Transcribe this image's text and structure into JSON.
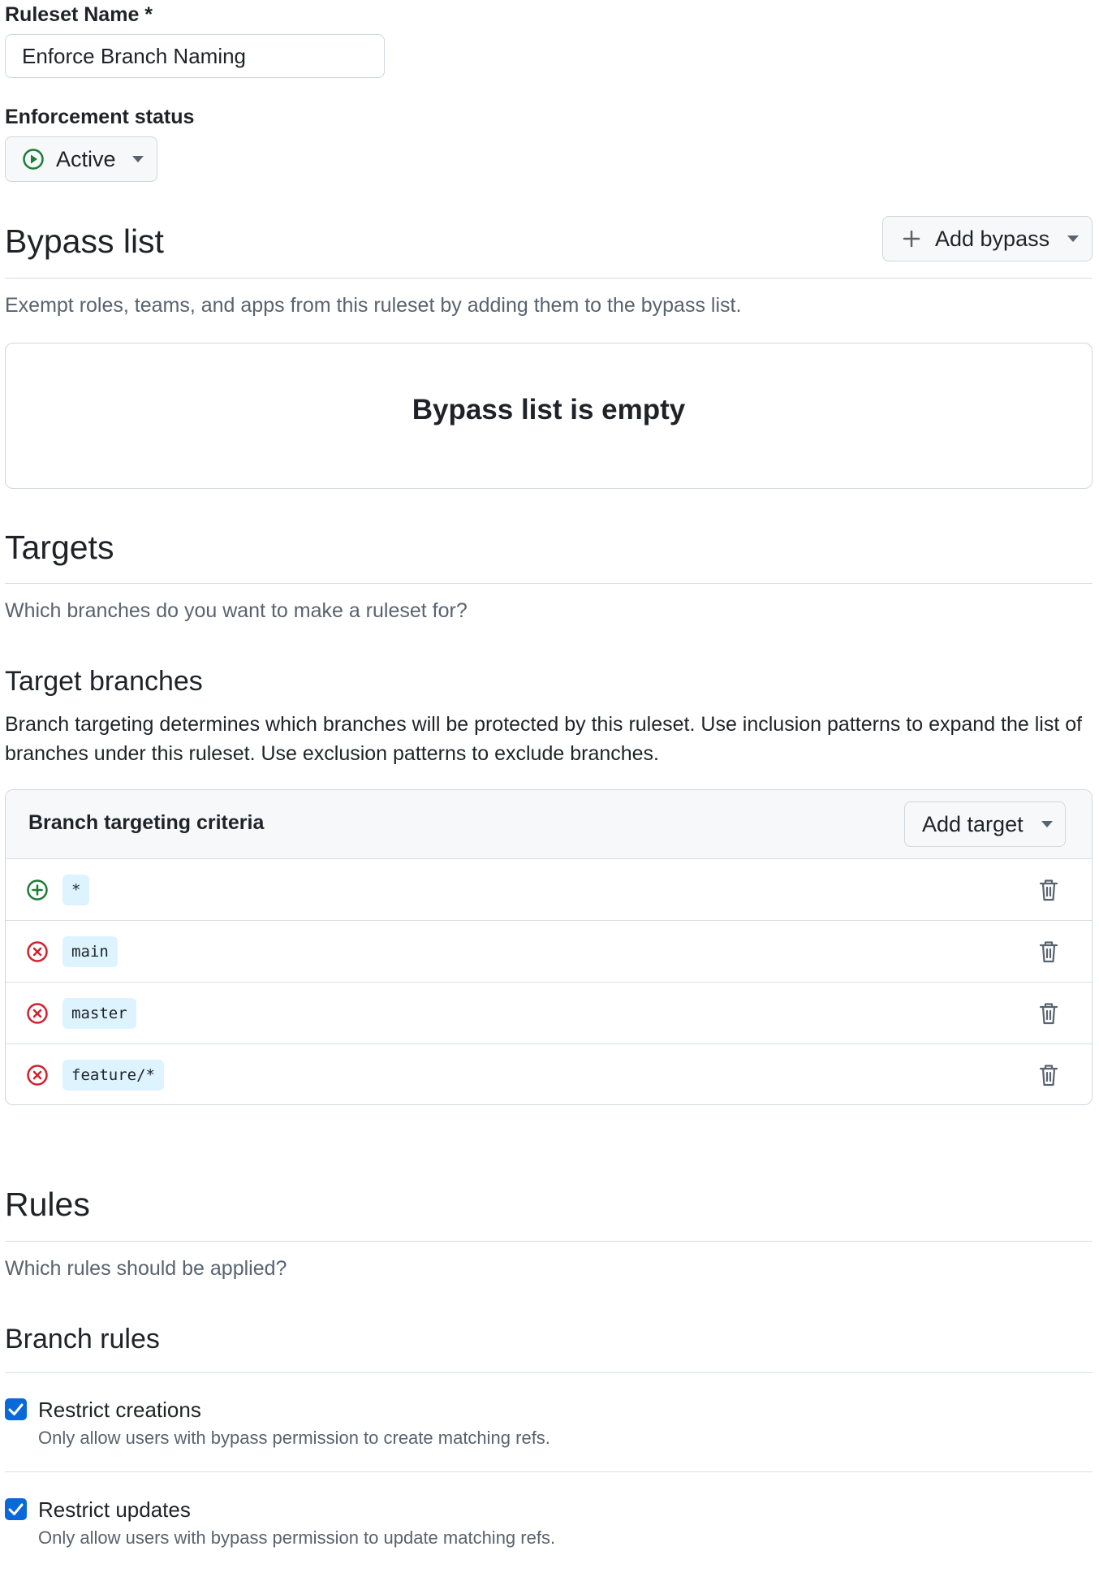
{
  "ruleset_name": {
    "label": "Ruleset Name *",
    "value": "Enforce Branch Naming"
  },
  "enforcement": {
    "label": "Enforcement status",
    "value": "Active"
  },
  "bypass": {
    "title": "Bypass list",
    "add_button": "Add bypass",
    "description": "Exempt roles, teams, and apps from this ruleset by adding them to the bypass list.",
    "empty_text": "Bypass list is empty"
  },
  "targets": {
    "title": "Targets",
    "description": "Which branches do you want to make a ruleset for?",
    "branches_title": "Target branches",
    "branches_description": "Branch targeting determines which branches will be protected by this ruleset. Use inclusion patterns to expand the list of branches under this ruleset. Use exclusion patterns to exclude branches.",
    "criteria_header": "Branch targeting criteria",
    "add_target_button": "Add target",
    "items": [
      {
        "pattern": "*",
        "type": "include"
      },
      {
        "pattern": "main",
        "type": "exclude"
      },
      {
        "pattern": "master",
        "type": "exclude"
      },
      {
        "pattern": "feature/*",
        "type": "exclude"
      }
    ]
  },
  "rules": {
    "title": "Rules",
    "description": "Which rules should be applied?",
    "branch_rules_title": "Branch rules",
    "items": [
      {
        "title": "Restrict creations",
        "description": "Only allow users with bypass permission to create matching refs.",
        "checked": true
      },
      {
        "title": "Restrict updates",
        "description": "Only allow users with bypass permission to update matching refs.",
        "checked": true
      }
    ]
  },
  "colors": {
    "include": "#1a7f37",
    "exclude": "#cf222e",
    "accent": "#0969da"
  }
}
